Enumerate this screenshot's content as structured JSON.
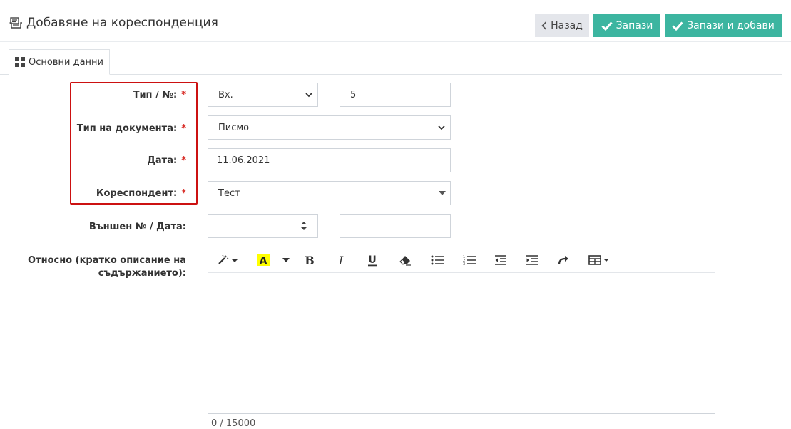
{
  "header": {
    "title": "Добавяне на кореспонденция",
    "back_label": "Назад",
    "save_label": "Запази",
    "save_add_label": "Запази и добави"
  },
  "tabs": [
    {
      "label": "Основни данни"
    }
  ],
  "form": {
    "type_number": {
      "label": "Тип / №:",
      "required": "*",
      "type_value": "Вх.",
      "number_value": "5"
    },
    "document_type": {
      "label": "Тип на документа:",
      "required": "*",
      "value": "Писмо"
    },
    "date": {
      "label": "Дата:",
      "required": "*",
      "value": "11.06.2021"
    },
    "correspondent": {
      "label": "Кореспондент:",
      "required": "*",
      "value": "Тест"
    },
    "external": {
      "label": "Външен № / Дата:",
      "number_value": "",
      "date_value": ""
    },
    "subject": {
      "label_line1": "Относно (кратко описание на",
      "label_line2": "съдържанието):",
      "value": "",
      "counter": "0 / 15000"
    }
  },
  "toolbar_icons": [
    "magic-wand-icon",
    "highlight-color-icon",
    "bold-icon",
    "italic-icon",
    "underline-icon",
    "eraser-icon",
    "unordered-list-icon",
    "ordered-list-icon",
    "outdent-icon",
    "indent-icon",
    "redo-icon",
    "table-icon"
  ],
  "colors": {
    "accent": "#3cb5a0",
    "back_button": "#e4e6eb",
    "required": "#d9312b",
    "highlight_border": "#cc1111",
    "highlight_yellow": "#ffff00"
  }
}
